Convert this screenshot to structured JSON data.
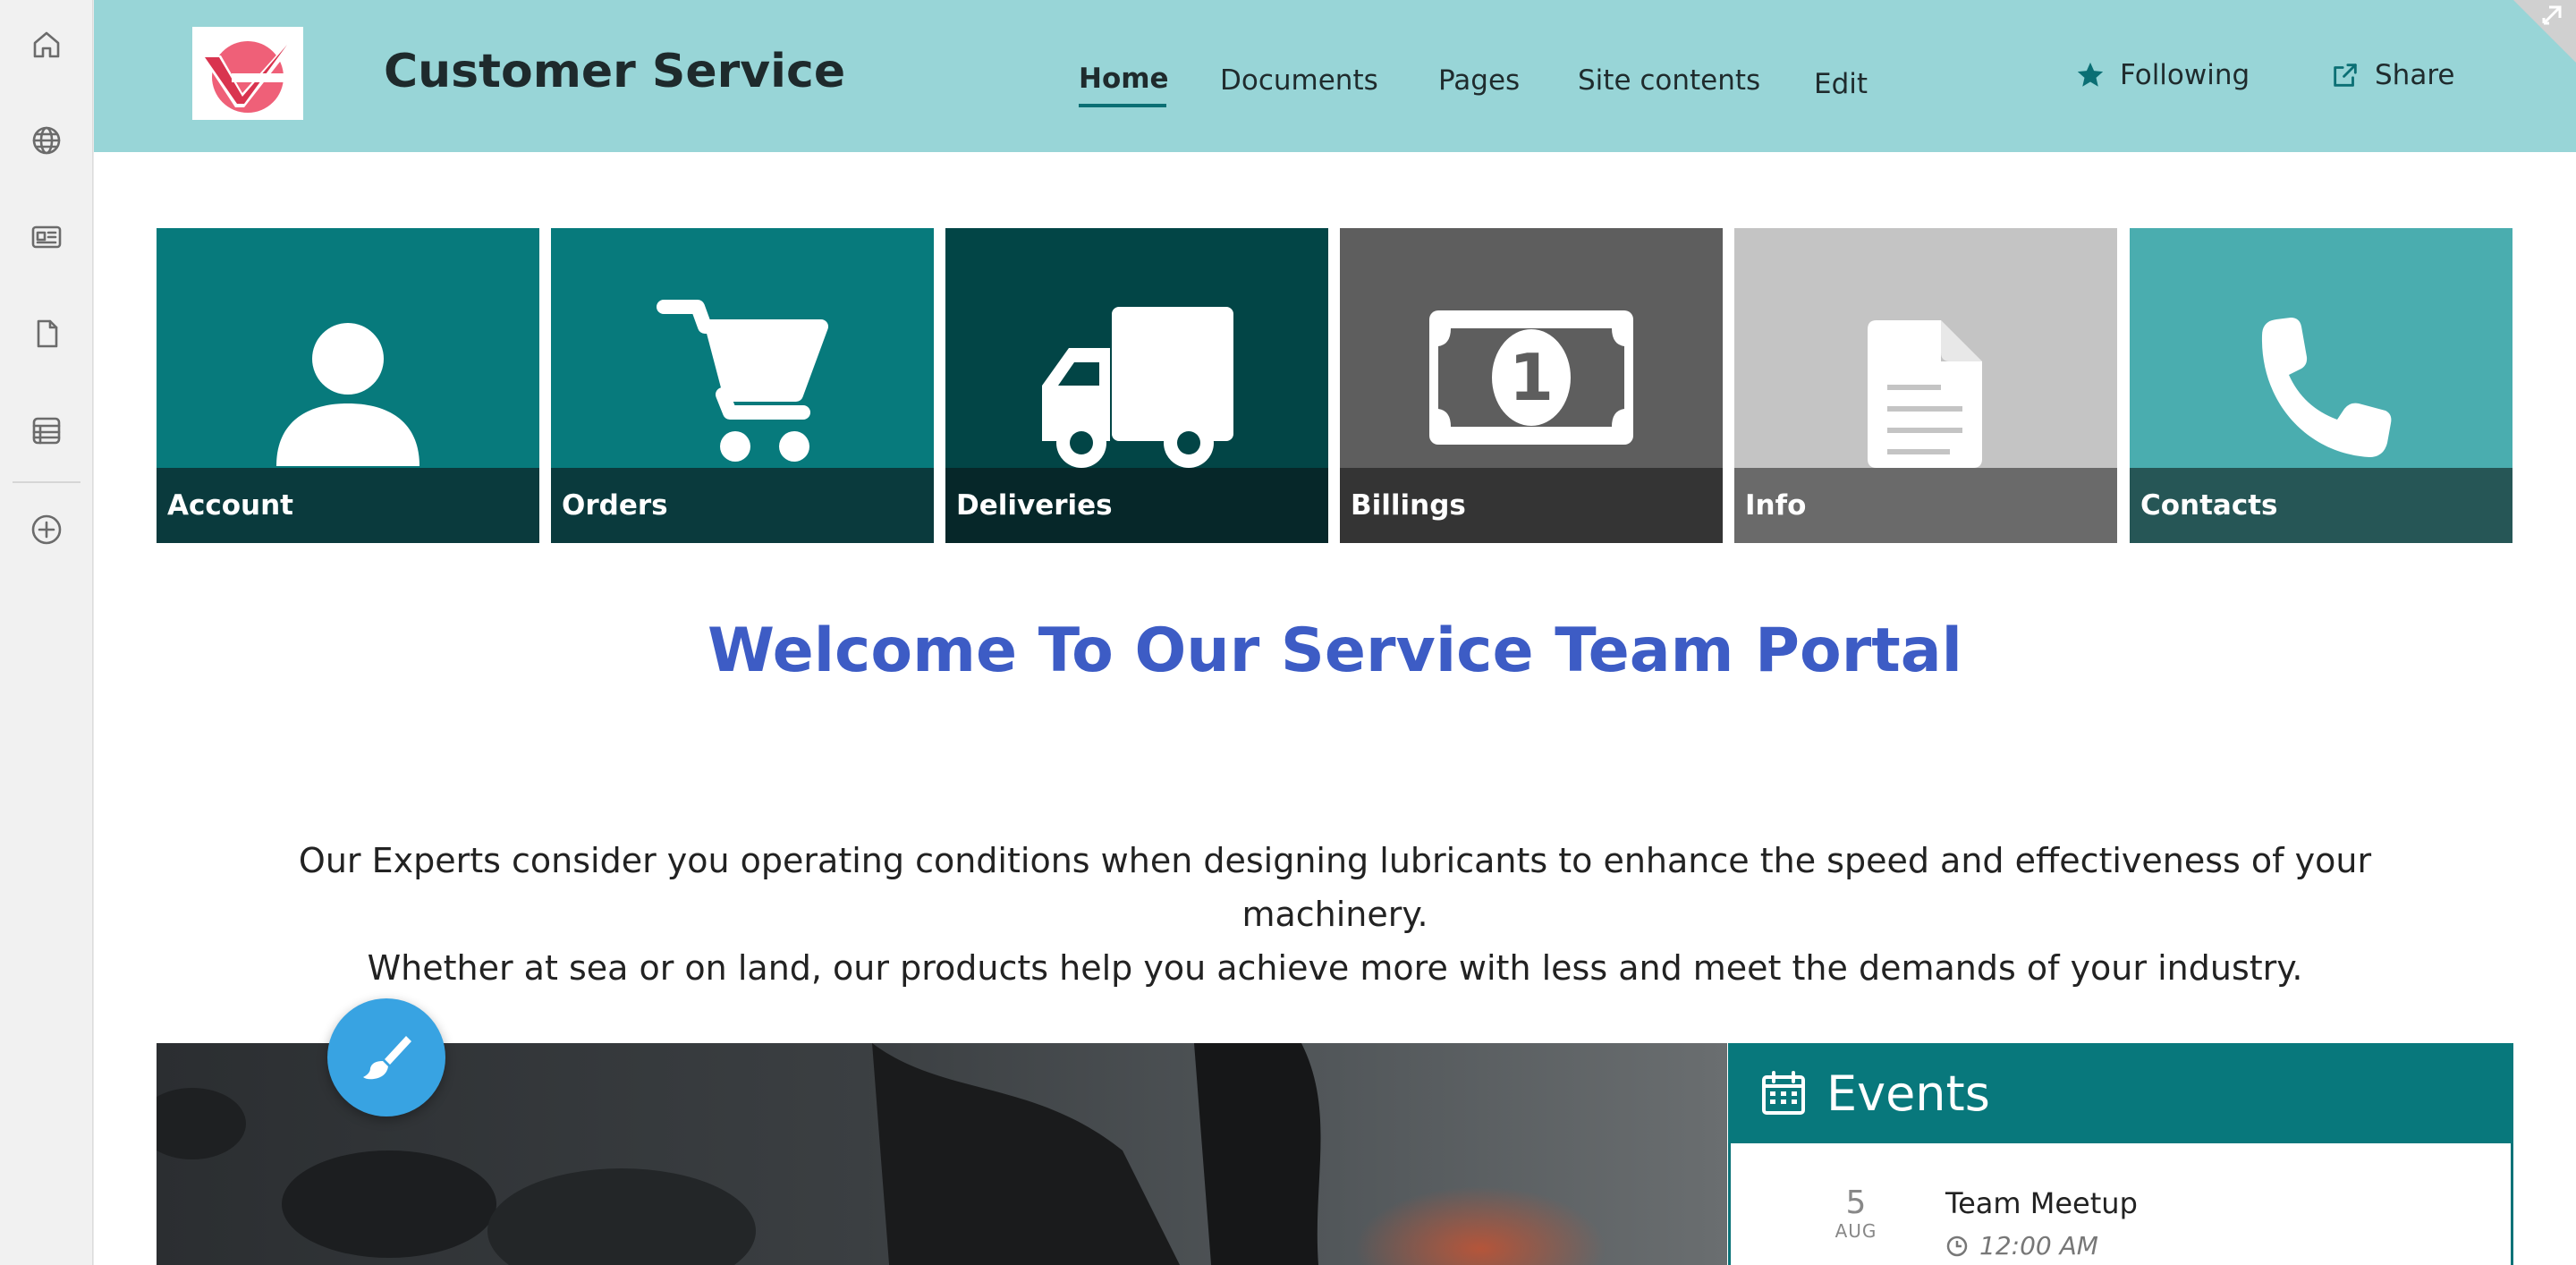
{
  "rail": {
    "items": [
      {
        "icon": "home-icon"
      },
      {
        "icon": "globe-icon"
      },
      {
        "icon": "news-icon"
      },
      {
        "icon": "document-icon"
      },
      {
        "icon": "list-icon"
      },
      {
        "icon": "add-circle-icon"
      }
    ]
  },
  "header": {
    "title": "Customer Service",
    "nav": [
      "Home",
      "Documents",
      "Pages",
      "Site contents",
      "Edit"
    ],
    "active_nav": "Home",
    "following_label": "Following",
    "share_label": "Share"
  },
  "tiles": [
    {
      "label": "Account",
      "icon": "person-icon",
      "bg": "#077a7c",
      "bar": "#0a3a3d"
    },
    {
      "label": "Orders",
      "icon": "cart-icon",
      "bg": "#077a7c",
      "bar": "#0a3a3d"
    },
    {
      "label": "Deliveries",
      "icon": "truck-icon",
      "bg": "#024546",
      "bar": "#062729"
    },
    {
      "label": "Billings",
      "icon": "banknote-icon",
      "bg": "#5e5e5e",
      "bar": "#343434"
    },
    {
      "label": "Info",
      "icon": "file-icon",
      "bg": "#c4c4c4",
      "bar": "#6a6a6a"
    },
    {
      "label": "Contacts",
      "icon": "phone-icon",
      "bg": "#4aadaf",
      "bar": "#265656"
    }
  ],
  "main": {
    "welcome": "Welcome To Our Service Team Portal",
    "intro_line1": "Our Experts consider you operating conditions when designing lubricants to enhance the speed and effectiveness of your machinery.",
    "intro_line2": "Whether at sea or on land, our products help you achieve more with less and meet the demands of your industry."
  },
  "events": {
    "title": "Events",
    "items": [
      {
        "day": "5",
        "month": "AUG",
        "title": "Team Meetup",
        "time": "12:00 AM"
      }
    ]
  },
  "colors": {
    "header_bg": "#98d5d7",
    "accent": "#0b6f74",
    "welcome_text": "#3d5cc5",
    "fab": "#38a3e2"
  }
}
